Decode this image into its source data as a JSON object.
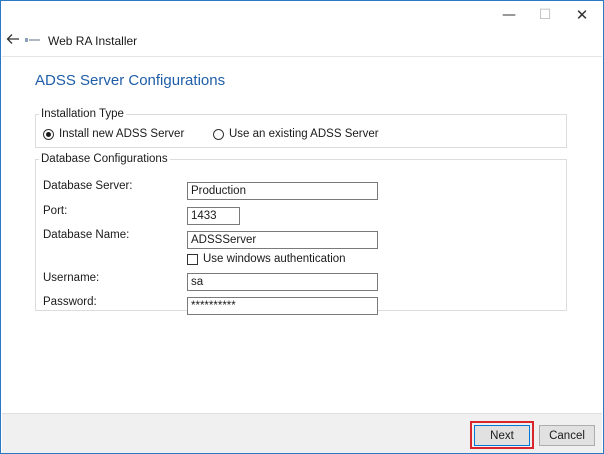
{
  "window": {
    "title": "Web RA  Installer",
    "controls": {
      "minimize": "—",
      "maximize": "☐",
      "close": "✕"
    }
  },
  "page": {
    "title": "ADSS Server Configurations"
  },
  "installation_type": {
    "legend": "Installation Type",
    "options": [
      {
        "label": "Install new ADSS Server",
        "selected": true
      },
      {
        "label": "Use an existing ADSS Server",
        "selected": false
      }
    ]
  },
  "database": {
    "legend": "Database Configurations",
    "server": {
      "label": "Database Server:",
      "value": "Production"
    },
    "port": {
      "label": "Port:",
      "value": "1433"
    },
    "name": {
      "label": "Database Name:",
      "value": "ADSSServer"
    },
    "windows_auth": {
      "label": "Use windows authentication",
      "checked": false
    },
    "username": {
      "label": "Username:",
      "value": "sa"
    },
    "password": {
      "label": "Password:",
      "value": "**********"
    }
  },
  "footer": {
    "next_label": "Next",
    "cancel_label": "Cancel"
  },
  "colors": {
    "accent": "#1f5da8",
    "border": "#2b78c4",
    "highlight": "#d9262c"
  }
}
